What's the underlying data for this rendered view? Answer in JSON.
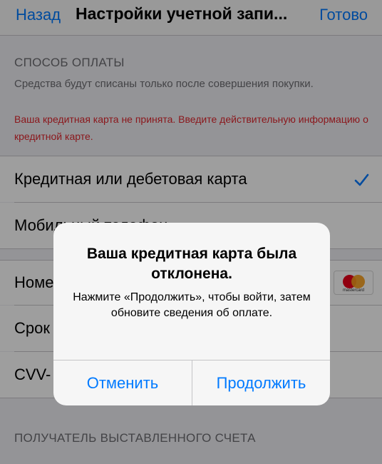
{
  "navbar": {
    "back_label": "Назад",
    "title": "Настройки учетной запи...",
    "done_label": "Готово"
  },
  "payment_section": {
    "header": "СПОСОБ ОПЛАТЫ",
    "description": "Средства будут списаны только после совершения покупки.",
    "error": "Ваша кредитная карта не принята. Введите действительную информацию о кредитной карте."
  },
  "payment_options": [
    {
      "label": "Кредитная или дебетовая карта",
      "selected": true
    },
    {
      "label": "Мобильный телефон",
      "selected": false
    }
  ],
  "card_fields": [
    {
      "label": "Номер"
    },
    {
      "label": "Срок"
    },
    {
      "label": "CVV-"
    }
  ],
  "card_brand": {
    "icon": "mastercard-icon",
    "text": "mastercard"
  },
  "billing_section": {
    "header": "ПОЛУЧАТЕЛЬ ВЫСТАВЛЕННОГО СЧЕТА"
  },
  "alert": {
    "title": "Ваша кредитная карта была отклонена.",
    "message": "Нажмите «Продолжить», чтобы войти, затем обновите сведения об оплате.",
    "cancel_label": "Отменить",
    "continue_label": "Продолжить"
  },
  "colors": {
    "accent": "#007aff",
    "error": "#e0282f",
    "background": "#efeff4"
  }
}
